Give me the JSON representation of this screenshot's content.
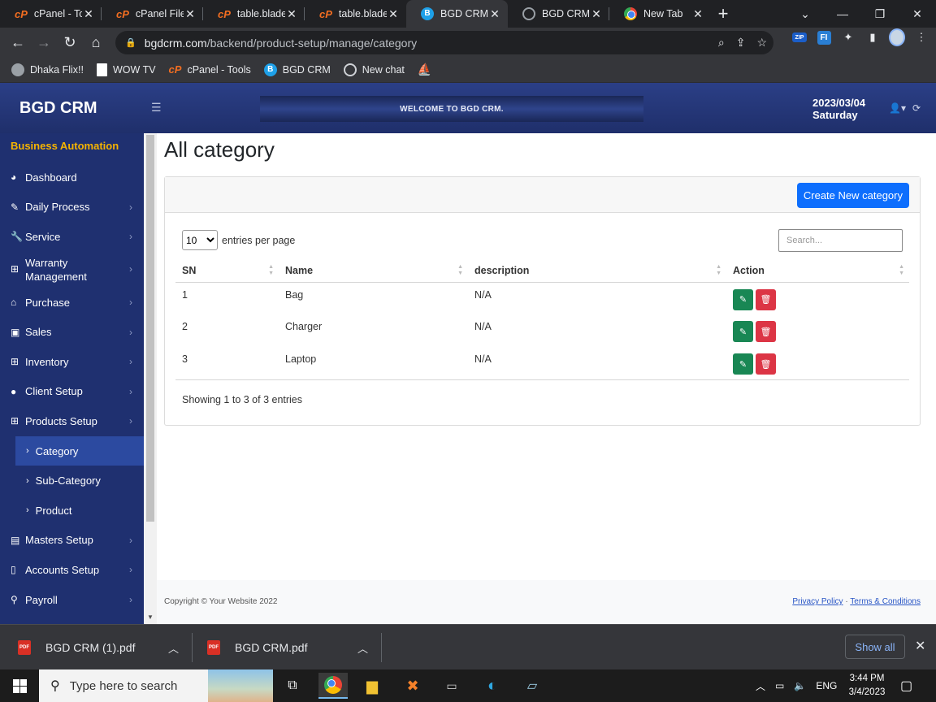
{
  "browser": {
    "tabs": [
      {
        "title": "cPanel - Tools",
        "icon": "cpanel-icon"
      },
      {
        "title": "cPanel File Manager",
        "icon": "cpanel-icon"
      },
      {
        "title": "table.blade.php",
        "icon": "cpanel-icon"
      },
      {
        "title": "table.blade.php",
        "icon": "cpanel-icon"
      },
      {
        "title": "BGD CRM",
        "icon": "bgd-icon",
        "active": true
      },
      {
        "title": "BGD CRM (",
        "icon": "globe-icon"
      },
      {
        "title": "New Tab",
        "icon": "chrome-icon"
      }
    ],
    "url_host": "bgdcrm.com",
    "url_path": "/backend/product-setup/manage/category",
    "bookmarks": [
      {
        "label": "Dhaka Flix!!"
      },
      {
        "label": "WOW TV"
      },
      {
        "label": "cPanel - Tools"
      },
      {
        "label": "BGD CRM"
      },
      {
        "label": "New chat"
      },
      {
        "label": ""
      }
    ]
  },
  "header": {
    "brand": "BGD CRM",
    "welcome": "WELCOME TO BGD CRM.",
    "date": "2023/03/04",
    "day": "Saturday"
  },
  "sidebar": {
    "heading": "Business Automation",
    "items": [
      {
        "label": "Dashboard",
        "icon": "dashboard-icon"
      },
      {
        "label": "Daily Process",
        "icon": "edit-icon"
      },
      {
        "label": "Service",
        "icon": "wrench-icon"
      },
      {
        "label": "Warranty Management",
        "icon": "table-icon"
      },
      {
        "label": "Purchase",
        "icon": "basket-icon"
      },
      {
        "label": "Sales",
        "icon": "bag-icon"
      },
      {
        "label": "Inventory",
        "icon": "table-icon"
      },
      {
        "label": "Client Setup",
        "icon": "user-icon"
      },
      {
        "label": "Products Setup",
        "icon": "table-icon"
      }
    ],
    "subitems": [
      {
        "label": "Category",
        "active": true
      },
      {
        "label": "Sub-Category"
      },
      {
        "label": "Product"
      }
    ],
    "items_after": [
      {
        "label": "Masters Setup",
        "icon": "id-card-icon"
      },
      {
        "label": "Accounts Setup",
        "icon": "file-icon"
      },
      {
        "label": "Payroll",
        "icon": "person-dolly-icon"
      }
    ]
  },
  "main": {
    "title": "All category",
    "create_button": "Create New category",
    "page_length": "10",
    "entries_label": "entries per page",
    "search_placeholder": "Search...",
    "columns": [
      "SN",
      "Name",
      "description",
      "Action"
    ],
    "rows": [
      {
        "sn": "1",
        "name": "Bag",
        "description": "N/A"
      },
      {
        "sn": "2",
        "name": "Charger",
        "description": "N/A"
      },
      {
        "sn": "3",
        "name": "Laptop",
        "description": "N/A"
      }
    ],
    "showing": "Showing 1 to 3 of 3 entries"
  },
  "footer": {
    "copyright": "Copyright © Your Website 2022",
    "privacy": "Privacy Policy",
    "dot": "·",
    "terms": "Terms & Conditions"
  },
  "downloads": {
    "files": [
      "BGD CRM (1).pdf",
      "BGD CRM.pdf"
    ],
    "show_all": "Show all"
  },
  "taskbar": {
    "search_placeholder": "Type here to search",
    "language": "ENG",
    "time": "3:44 PM",
    "date": "3/4/2023"
  },
  "colors": {
    "sidebar": "#1f3070",
    "header": "#2b3f86",
    "accent_heading": "#f5b301",
    "primary_button": "#0d6efd",
    "edit_button": "#198754",
    "delete_button": "#dc3545"
  }
}
